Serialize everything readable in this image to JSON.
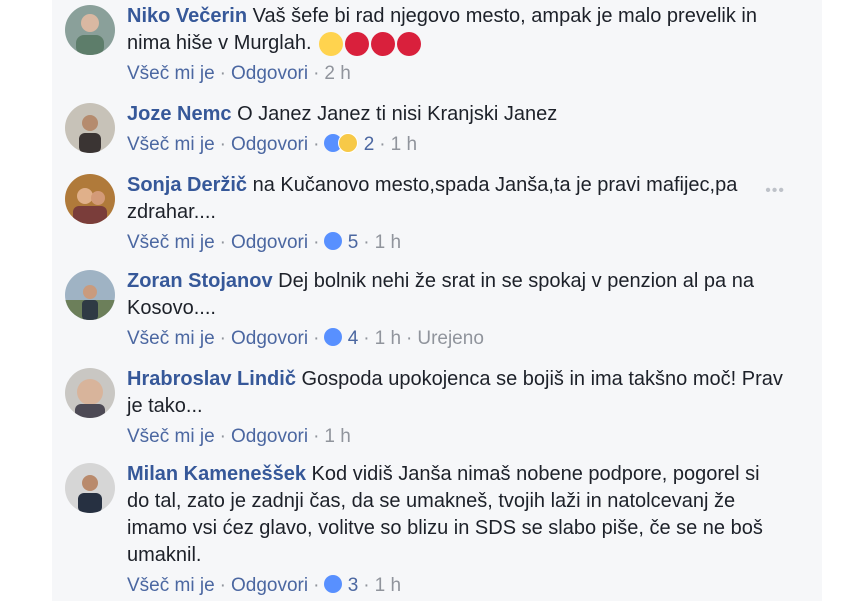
{
  "actions": {
    "like": "Všeč mi je",
    "reply": "Odgovori"
  },
  "comments": [
    {
      "name": "Niko Večerin",
      "text": "Vaš šefe bi rad njegovo mesto, ampak je malo prevelik in nima hiše v Murglah.",
      "time": "2 h",
      "reactions": "",
      "edited": "",
      "emojis": [
        "fearful-face-emoji",
        "devil-face-emoji",
        "devil-face-emoji",
        "devil-face-emoji"
      ]
    },
    {
      "name": "Joze Nemc",
      "text": "O Janez Janez ti nisi Kranjski Janez",
      "time": "1 h",
      "reactions": "2",
      "edited": ""
    },
    {
      "name": "Sonja Deržič",
      "text": "na Kučanovo mesto,spada Janša,ta je pravi mafijec,pa zdrahar....",
      "time": "1 h",
      "reactions": "5",
      "edited": ""
    },
    {
      "name": "Zoran Stojanov",
      "text": "Dej bolnik nehi že srat in se spokaj v penzion al pa na Kosovo....",
      "time": "1 h",
      "reactions": "4",
      "edited": "Urejeno"
    },
    {
      "name": "Hrabroslav Lindič",
      "text": "Gospoda upokojenca se bojiš in ima takšno moč! Prav je tako...",
      "time": "1 h",
      "reactions": "",
      "edited": ""
    },
    {
      "name": "Milan Kameneššek",
      "text": "Kod vidiš Janša nimaš nobene podpore, pogorel si do tal, zato je zadnji čas, da se umakneš, tvojih laži in natolcevanj že imamo vsi ćez glavo, volitve so blizu in SDS se slabo piše, če se ne boš umaknil.",
      "time": "1 h",
      "reactions": "3",
      "edited": ""
    }
  ],
  "more_glyph": "•••",
  "colors": {
    "name": "#365899",
    "link": "#4b67a1",
    "meta": "#90949c",
    "like": "#5890ff"
  }
}
